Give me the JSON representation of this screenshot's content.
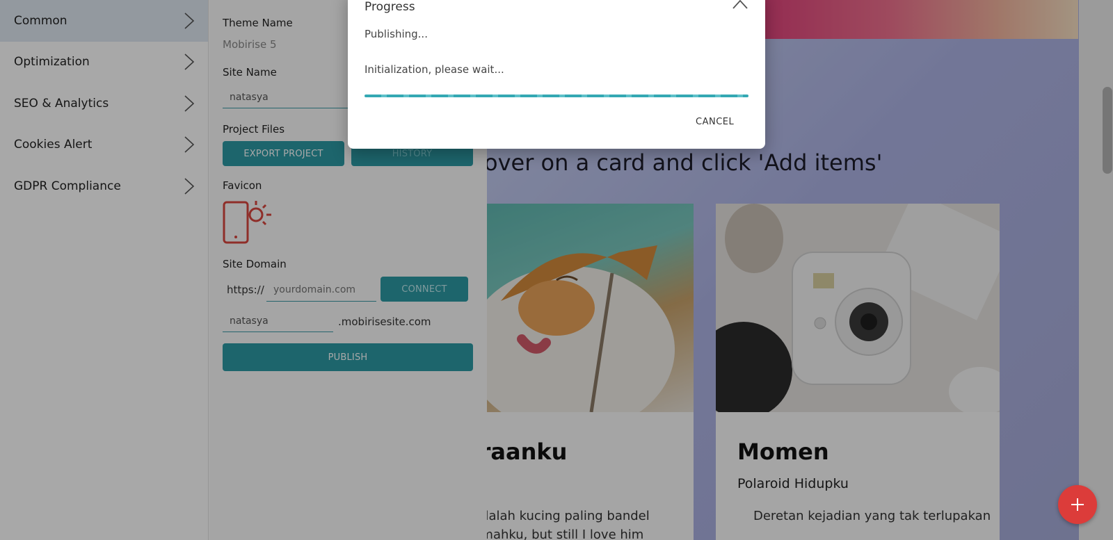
{
  "sidebar": {
    "items": [
      {
        "label": "Common"
      },
      {
        "label": "Optimization"
      },
      {
        "label": "SEO & Analytics"
      },
      {
        "label": "Cookies Alert"
      },
      {
        "label": "GDPR Compliance"
      }
    ]
  },
  "panel": {
    "theme_name_label": "Theme Name",
    "theme_name_value": "Mobirise 5",
    "site_name_label": "Site Name",
    "site_name_value": "natasya",
    "project_files_label": "Project Files",
    "export_button": "EXPORT PROJECT",
    "history_button": "HISTORY",
    "favicon_label": "Favicon",
    "site_domain_label": "Site Domain",
    "domain_prefix": "https://",
    "domain_placeholder": "yourdomain.com",
    "connect_button": "CONNECT",
    "subdomain_value": "natasya",
    "subdomain_suffix": ".mobirisesite.com",
    "publish_button": "PUBLISH"
  },
  "canvas": {
    "headline": "over on a card and click 'Add items'",
    "cards": [
      {
        "title": "araanku",
        "body_line1": "adalah kucing paling bandel",
        "body_line2": "umahku, but still I love him"
      },
      {
        "title": "Momen",
        "subtitle": "Polaroid Hidupku",
        "body_line1": "Deretan kejadian yang tak terlupakan"
      }
    ]
  },
  "dialog": {
    "title": "Progress",
    "status": "Publishing...",
    "message": "Initialization, please wait...",
    "cancel_button": "CANCEL"
  },
  "colors": {
    "accent": "#2c9aa5",
    "fab": "#dc3c3a"
  }
}
